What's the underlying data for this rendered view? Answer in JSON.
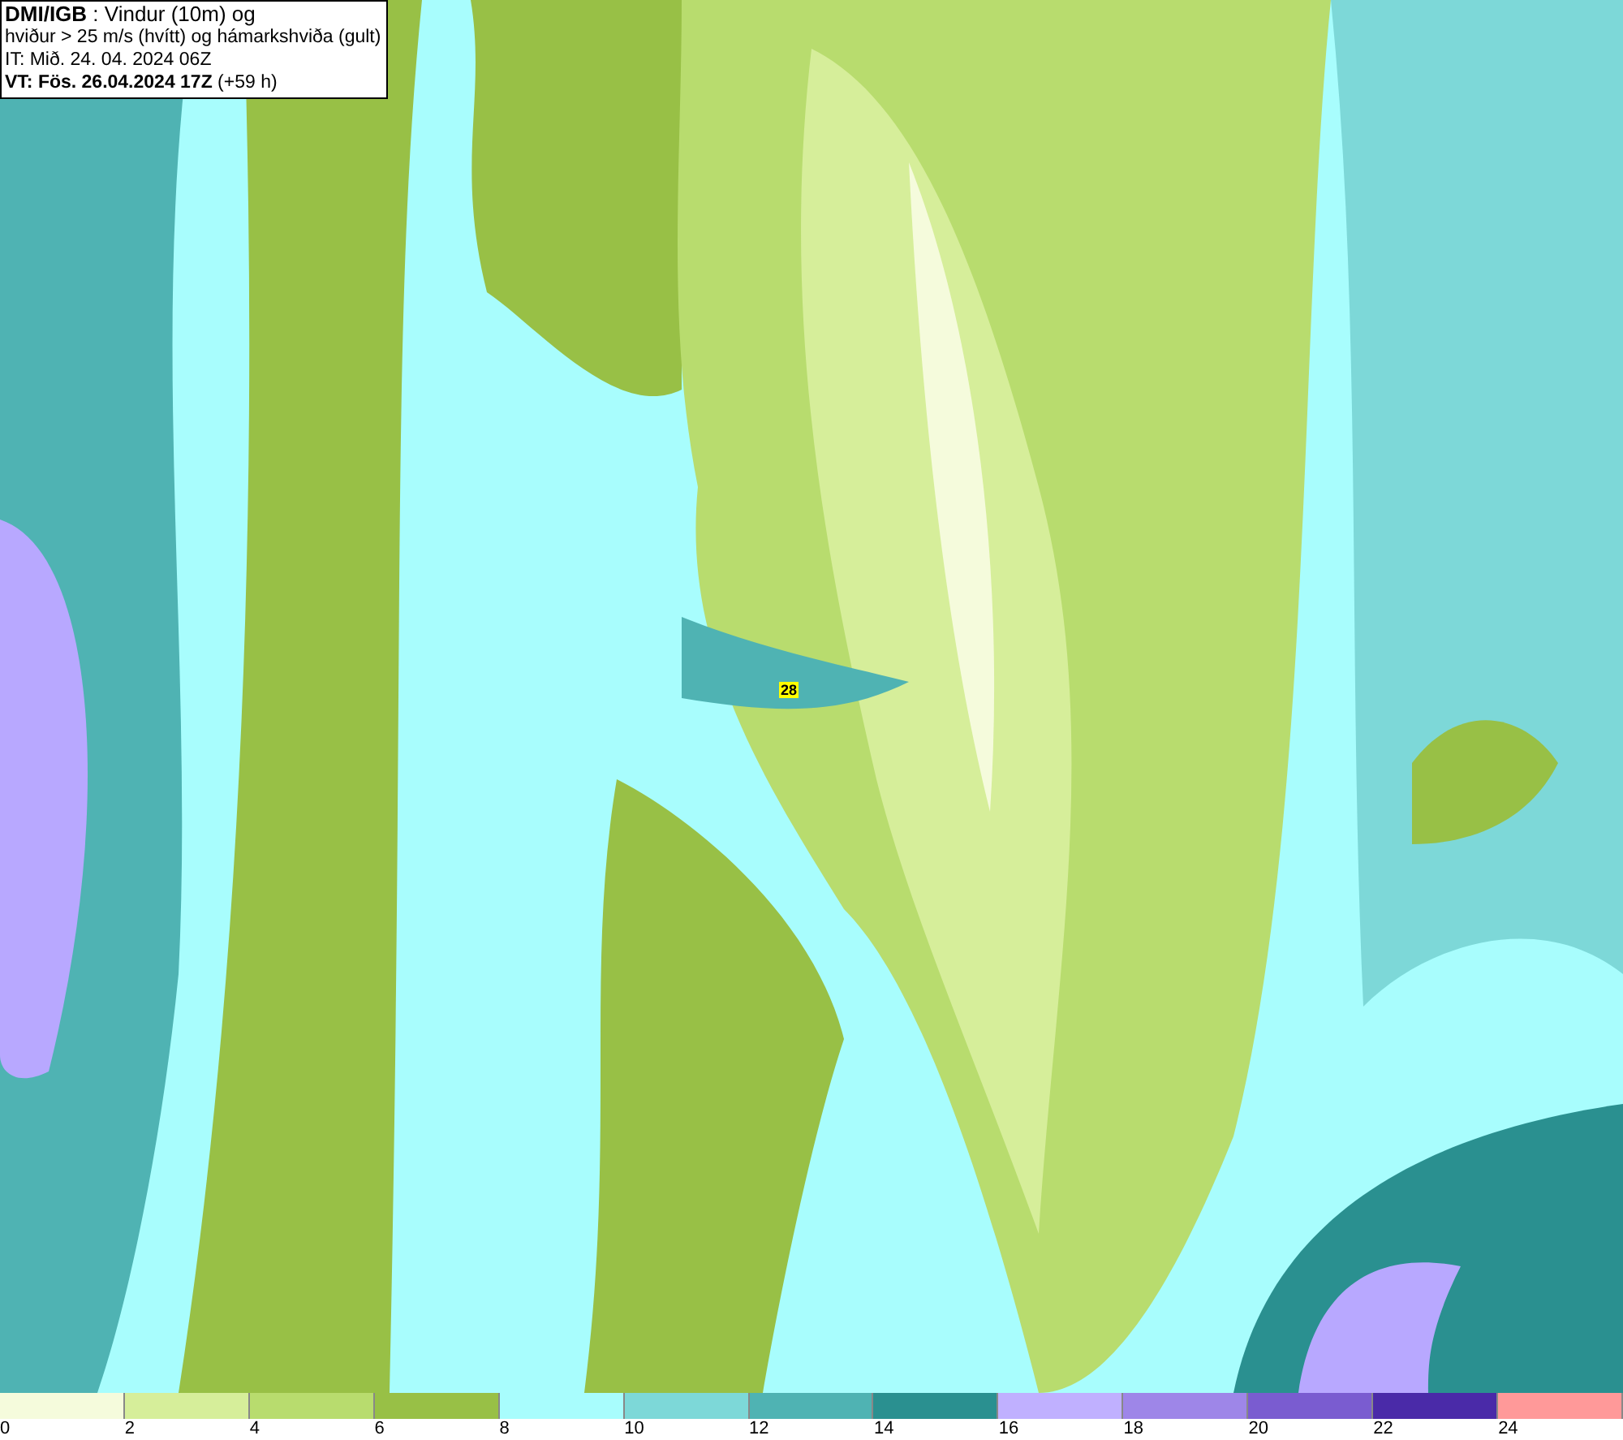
{
  "legend": {
    "lines": [
      "**DMI/IGB** : Vindur (10m) og",
      "hviður > 25 m/s (hvítt) og hámarkshviða (gult)",
      "IT: Mið. 24. 04. 2024 06Z",
      "**VT: Fös. 26.04.2024 17Z** (+59 h)"
    ]
  },
  "max_gust_marker": {
    "label": "28"
  },
  "colorbar": [
    {
      "color": "#f5fbdc",
      "label": "0"
    },
    {
      "color": "#d6ee9a",
      "label": "2"
    },
    {
      "color": "#b8dc6e",
      "label": "4"
    },
    {
      "color": "#98c046",
      "label": "6"
    },
    {
      "color": "#a8fdfd",
      "label": "8"
    },
    {
      "color": "#7dd8d8",
      "label": "10"
    },
    {
      "color": "#4fb3b3",
      "label": "12"
    },
    {
      "color": "#2a9090",
      "label": "14"
    },
    {
      "color": "#c0b0ff",
      "label": "16"
    },
    {
      "color": "#9e86e8",
      "label": "18"
    },
    {
      "color": "#7a5cd0",
      "label": "20"
    },
    {
      "color": "#4a2aa8",
      "label": "22"
    },
    {
      "color": "#ff9999",
      "label": "24"
    }
  ]
}
